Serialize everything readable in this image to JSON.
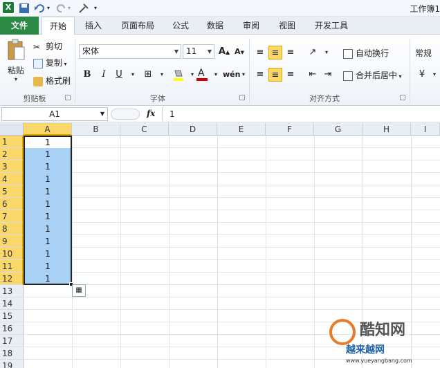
{
  "window": {
    "title": "工作簿1"
  },
  "tabs": [
    {
      "label": "文件"
    },
    {
      "label": "开始"
    },
    {
      "label": "插入"
    },
    {
      "label": "页面布局"
    },
    {
      "label": "公式"
    },
    {
      "label": "数据"
    },
    {
      "label": "审阅"
    },
    {
      "label": "视图"
    },
    {
      "label": "开发工具"
    }
  ],
  "ribbon": {
    "clipboard": {
      "paste": "粘贴",
      "cut": "剪切",
      "copy": "复制",
      "format_painter": "格式刷",
      "group": "剪贴板"
    },
    "font": {
      "name": "宋体",
      "size": "11",
      "bold": "B",
      "italic": "I",
      "underline": "U",
      "group": "字体"
    },
    "alignment": {
      "wrap": "自动换行",
      "merge": "合并后居中",
      "group": "对齐方式"
    },
    "number": {
      "format": "常规"
    }
  },
  "formula_bar": {
    "name_box": "A1",
    "fx": "fx",
    "value": "1"
  },
  "columns": [
    "A",
    "B",
    "C",
    "D",
    "E",
    "F",
    "G",
    "H",
    "I"
  ],
  "rows": [
    "1",
    "2",
    "3",
    "4",
    "5",
    "6",
    "7",
    "8",
    "9",
    "10",
    "11",
    "12",
    "13",
    "14",
    "15",
    "16",
    "17",
    "18",
    "19"
  ],
  "cells_a": [
    "1",
    "1",
    "1",
    "1",
    "1",
    "1",
    "1",
    "1",
    "1",
    "1",
    "1",
    "1"
  ],
  "watermark": {
    "line1": "酷知网",
    "line2": "越来越网",
    "line3": "www.yueyangbang.com"
  },
  "colors": {
    "file_tab": "#2a8a44",
    "selection": "#a9d0f5",
    "header_selected": "#f9d76a"
  }
}
